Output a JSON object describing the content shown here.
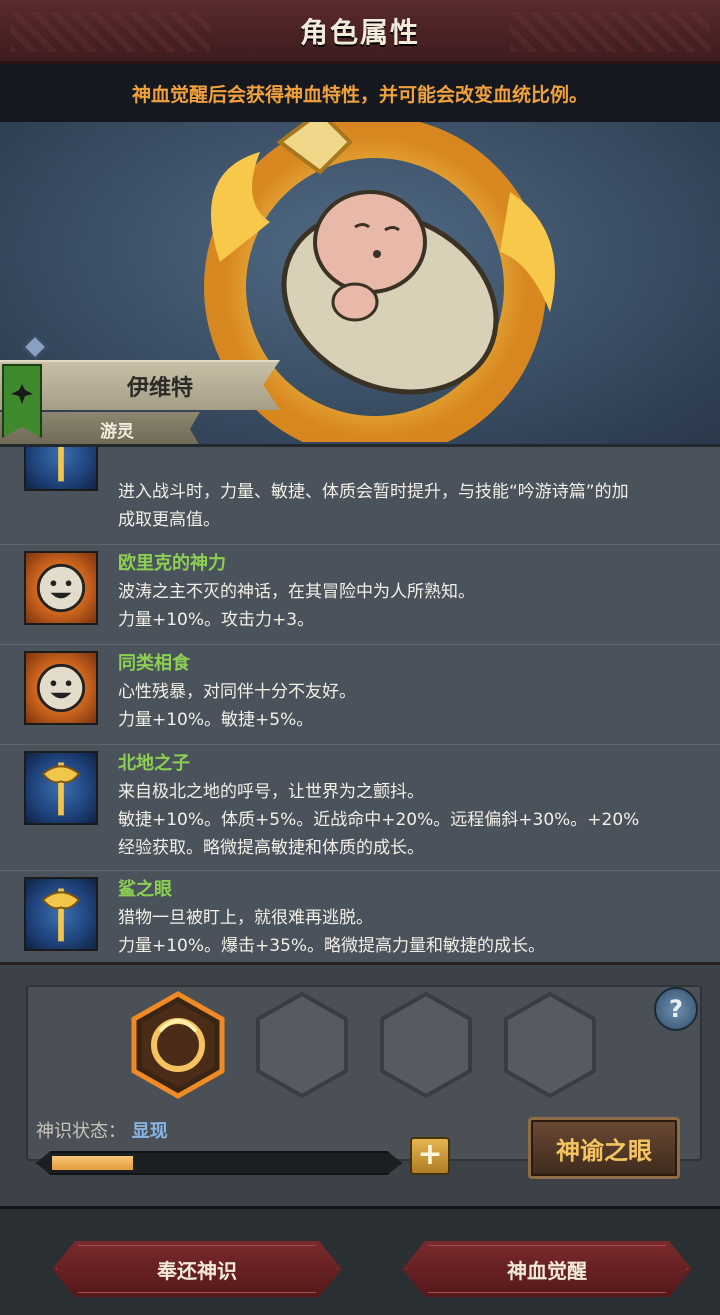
{
  "header": {
    "title": "角色属性"
  },
  "notice": {
    "text": "神血觉醒后会获得神血特性，并可能会改变血统比例。"
  },
  "character": {
    "name": "伊维特",
    "class": "游灵"
  },
  "traits": [
    {
      "name": "",
      "icon": "axe-icon",
      "lines": [
        "进入战斗时，力量、敏捷、体质会暂时提升，与技能“吟游诗篇”的加",
        "成取更高值。"
      ]
    },
    {
      "name": "欧里克的神力",
      "icon": "smiley-face-icon",
      "lines": [
        "波涛之主不灭的神话，在其冒险中为人所熟知。",
        "力量+10%。攻击力+3。"
      ]
    },
    {
      "name": "同类相食",
      "icon": "smiley-face-icon",
      "lines": [
        "心性残暴，对同伴十分不友好。",
        "力量+10%。敏捷+5%。"
      ]
    },
    {
      "name": "北地之子",
      "icon": "axe-icon",
      "lines": [
        "来自极北之地的呼号，让世界为之颤抖。",
        "敏捷+10%。体质+5%。近战命中+20%。远程偏斜+30%。+20%",
        "经验获取。略微提高敏捷和体质的成长。"
      ]
    },
    {
      "name": "鲨之眼",
      "icon": "axe-icon",
      "lines": [
        "猎物一旦被盯上，就很难再逃脱。",
        "力量+10%。爆击+35%。略微提高力量和敏捷的成长。"
      ]
    }
  ],
  "divine": {
    "state_label": "神识状态：",
    "state_value": "显现",
    "progress": 0.24,
    "plus_label": "+",
    "help_label": "?",
    "oracle_button": "神谕之眼"
  },
  "footer": {
    "return_button": "奉还神识",
    "awaken_button": "神血觉醒"
  },
  "colors": {
    "trait_name": "#8ccf52",
    "notice": "#f0a03c",
    "accent_gold": "#f5c460"
  }
}
